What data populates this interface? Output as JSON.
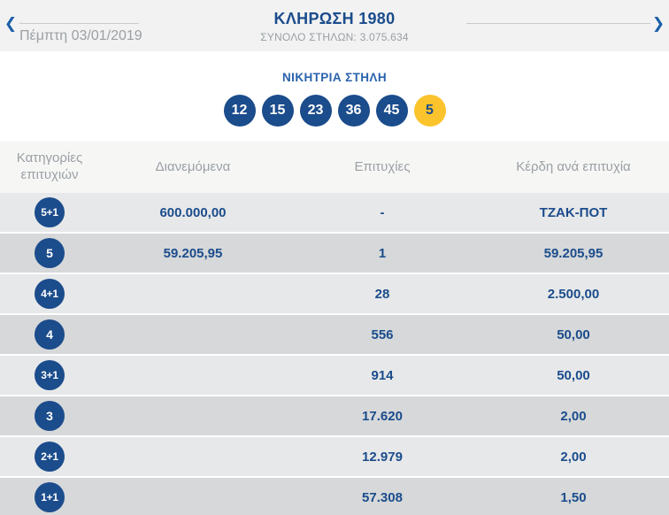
{
  "header": {
    "title": "ΚΛΗΡΩΣΗ 1980",
    "subtitle": "ΣΥΝΟΛΟ ΣΤΗΛΩΝ: 3.075.634",
    "date": "Πέμπτη 03/01/2019",
    "chevron_left": "❮",
    "chevron_right": "❯"
  },
  "winning": {
    "heading": "ΝΙΚΗΤΡΙΑ ΣΤΗΛΗ",
    "numbers": [
      "12",
      "15",
      "23",
      "36",
      "45"
    ],
    "joker": "5"
  },
  "table": {
    "col_categories": "Κατηγορίες επιτυχιών",
    "col_distributed": "Διανεμόμενα",
    "col_winners": "Επιτυχίες",
    "col_payout": "Κέρδη ανά επιτυχία",
    "rows": [
      {
        "category": "5+1",
        "distributed": "600.000,00",
        "winners": "-",
        "payout": "ΤΖΑΚ-ΠΟΤ"
      },
      {
        "category": "5",
        "distributed": "59.205,95",
        "winners": "1",
        "payout": "59.205,95"
      },
      {
        "category": "4+1",
        "distributed": "",
        "winners": "28",
        "payout": "2.500,00"
      },
      {
        "category": "4",
        "distributed": "",
        "winners": "556",
        "payout": "50,00"
      },
      {
        "category": "3+1",
        "distributed": "",
        "winners": "914",
        "payout": "50,00"
      },
      {
        "category": "3",
        "distributed": "",
        "winners": "17.620",
        "payout": "2,00"
      },
      {
        "category": "2+1",
        "distributed": "",
        "winners": "12.979",
        "payout": "2,00"
      },
      {
        "category": "1+1",
        "distributed": "",
        "winners": "57.308",
        "payout": "1,50"
      }
    ]
  },
  "colors": {
    "navy": "#1b4c8c",
    "heading_blue": "#2862ac",
    "joker_yellow": "#fbc42d",
    "row_light": "#e7e8e9",
    "row_dark": "#d6d8d9",
    "muted_text": "#9aa0a4",
    "topbar_bg": "#f2f2f2",
    "thead_bg": "#f6f6f5"
  }
}
